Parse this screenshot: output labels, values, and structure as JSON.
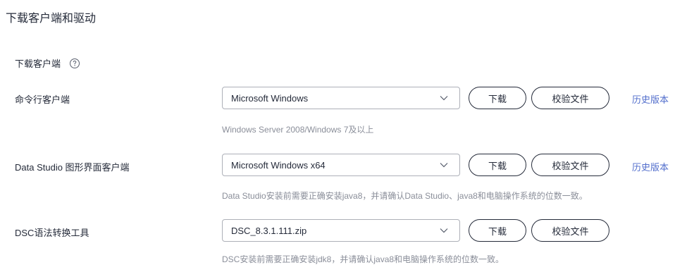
{
  "page": {
    "title": "下载客户端和驱动"
  },
  "section": {
    "title": "下载客户端"
  },
  "rows": [
    {
      "label": "命令行客户端",
      "selected": "Microsoft Windows",
      "download_label": "下载",
      "verify_label": "校验文件",
      "history_label": "历史版本",
      "hint": "Windows Server 2008/Windows 7及以上"
    },
    {
      "label": "Data Studio 图形界面客户端",
      "selected": "Microsoft Windows x64",
      "download_label": "下载",
      "verify_label": "校验文件",
      "history_label": "历史版本",
      "hint": "Data Studio安装前需要正确安装java8，并请确认Data Studio、java8和电脑操作系统的位数一致。"
    },
    {
      "label": "DSC语法转换工具",
      "selected": "DSC_8.3.1.111.zip",
      "download_label": "下载",
      "verify_label": "校验文件",
      "hint": "DSC安装前需要正确安装jdk8，并请确认java8和电脑操作系统的位数一致。"
    }
  ],
  "colors": {
    "link": "#526ecc",
    "hint": "#8a8e99",
    "text": "#252b3a",
    "border": "#adb0b8"
  },
  "icons": {
    "help": "help-circle-icon",
    "dropdown": "chevron-down-icon"
  }
}
